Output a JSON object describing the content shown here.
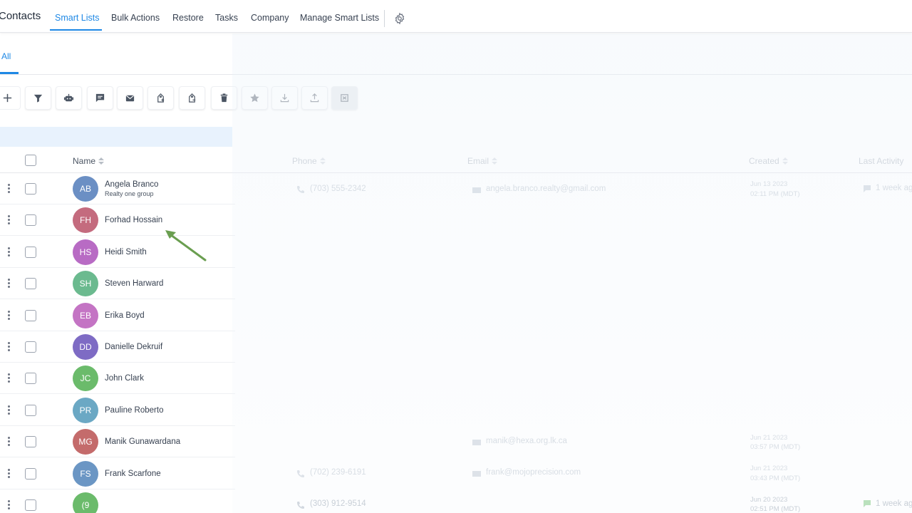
{
  "app": {
    "title": "Contacts"
  },
  "nav": {
    "tabs": [
      {
        "label": "Smart Lists"
      },
      {
        "label": "Bulk Actions"
      },
      {
        "label": "Restore"
      },
      {
        "label": "Tasks"
      },
      {
        "label": "Company"
      },
      {
        "label": "Manage Smart Lists"
      }
    ]
  },
  "subtabs": {
    "all": "All"
  },
  "toolbar": {
    "buttons": [
      "add-icon",
      "filter-icon",
      "robot-icon",
      "message-icon",
      "email-icon",
      "tag-add-icon",
      "tag-remove-icon",
      "trash-icon",
      "star-icon",
      "download-icon",
      "upload-icon",
      "merge-icon"
    ]
  },
  "table": {
    "headers": {
      "name": "Name",
      "phone": "Phone",
      "email": "Email",
      "created": "Created",
      "last_activity": "Last Activity"
    },
    "rows": [
      {
        "initials": "AB",
        "name": "Angela Branco",
        "company": "Realty one group",
        "color": "#6b8fc4"
      },
      {
        "initials": "FH",
        "name": "Forhad Hossain",
        "company": "",
        "color": "#c46b7e"
      },
      {
        "initials": "HS",
        "name": "Heidi Smith",
        "company": "",
        "color": "#b86bc4"
      },
      {
        "initials": "SH",
        "name": "Steven Harward",
        "company": "",
        "color": "#6bba8f"
      },
      {
        "initials": "EB",
        "name": "Erika Boyd",
        "company": "",
        "color": "#c474c4"
      },
      {
        "initials": "DD",
        "name": "Danielle Dekruif",
        "company": "",
        "color": "#7e6bc4"
      },
      {
        "initials": "JC",
        "name": "John Clark",
        "company": "",
        "color": "#6bbb6b"
      },
      {
        "initials": "PR",
        "name": "Pauline Roberto",
        "company": "",
        "color": "#6ba8c4"
      },
      {
        "initials": "MG",
        "name": "Manik Gunawardana",
        "company": "",
        "color": "#c46b6b"
      },
      {
        "initials": "FS",
        "name": "Frank Scarfone",
        "company": "",
        "color": "#6b96c4"
      },
      {
        "initials": "(9",
        "name": "",
        "company": "",
        "color": "#6bbb6b"
      }
    ],
    "ghost": {
      "r0_phone": "(703) 555-2342",
      "r0_email": "angela.branco.realty@gmail.com",
      "r0_created": "Jun 13 2023",
      "r0_created_time": "02:11 PM (MDT)",
      "r0_activity": "1 week ago",
      "r8_email": "manik@hexa.org.lk.ca",
      "r8_created": "Jun 21 2023",
      "r8_created_time": "03:57 PM (MDT)",
      "r9_phone": "(702) 239-6191",
      "r9_email": "frank@mojoprecision.com",
      "r9_created": "Jun 21 2023",
      "r9_created_time": "03:43 PM (MDT)",
      "r10_phone": "(303) 912-9514",
      "r10_created": "Jun 20 2023",
      "r10_created_time": "02:51 PM (MDT)",
      "r10_activity": "1 week ago"
    }
  },
  "colors": {
    "accent": "#1e88e5",
    "annotation_arrow": "#6a9e50"
  }
}
